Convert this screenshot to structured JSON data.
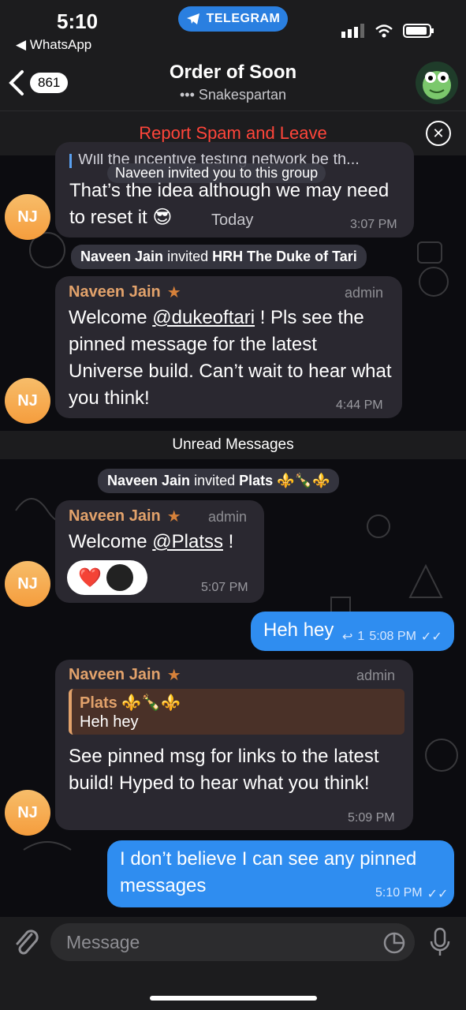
{
  "status": {
    "time": "5:10",
    "back_app": "◀ WhatsApp",
    "telegram_label": "TELEGRAM"
  },
  "header": {
    "unread_count": "861",
    "title": "Order of Soon",
    "subtitle": "••• Snakespartan"
  },
  "report": {
    "label": "Report Spam and Leave"
  },
  "messages": {
    "m1": {
      "quote": "Will the incentive testing network be th...",
      "inline_service": "Naveen invited you to this group",
      "text": "That’s the idea although we may need to reset it 😎",
      "overlay": "Today",
      "time": "3:07 PM"
    },
    "s1": {
      "name": "Naveen Jain",
      "mid": " invited ",
      "target": "HRH The Duke of Tari"
    },
    "m2": {
      "sender": "Naveen Jain",
      "role": "admin",
      "mention": "@dukeoftari",
      "text_before": "Welcome ",
      "text_after": " ! Pls see the pinned message for the latest Universe build. Can’t wait to hear what you think!",
      "time": "4:44 PM"
    },
    "unread_label": "Unread Messages",
    "s2": {
      "name": "Naveen Jain",
      "mid": " invited ",
      "target": "Plats ⚜️🍾⚜️"
    },
    "m3": {
      "sender": "Naveen Jain",
      "role": "admin",
      "text_before": "Welcome ",
      "mention": "@Platss",
      "text_after": " !",
      "reaction": "❤️",
      "time": "5:07 PM"
    },
    "m4": {
      "text": "Heh hey",
      "replies": "1",
      "time": "5:08 PM",
      "checks": "✓✓"
    },
    "m5": {
      "sender": "Naveen Jain",
      "role": "admin",
      "reply_name": "Plats ⚜️🍾⚜️",
      "reply_text": "Heh hey",
      "text": "See pinned msg for links to the latest build! Hyped to hear what you think!",
      "time": "5:09 PM"
    },
    "m6": {
      "text": "I don’t believe I can see any pinned messages",
      "time": "5:10 PM",
      "checks": "✓✓"
    }
  },
  "avatar_initials": "NJ",
  "input": {
    "placeholder": "Message"
  }
}
